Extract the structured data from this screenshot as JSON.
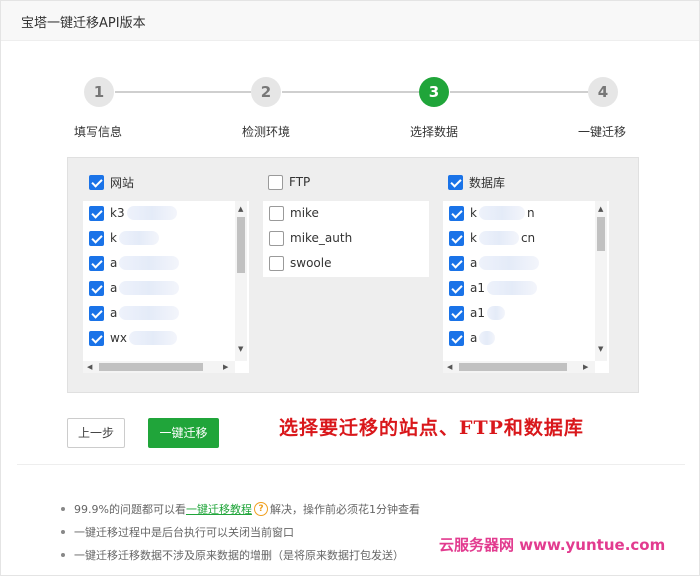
{
  "window": {
    "title": "宝塔一键迁移API版本"
  },
  "steps": [
    {
      "number": "1",
      "label": "填写信息",
      "active": false
    },
    {
      "number": "2",
      "label": "检测环境",
      "active": false
    },
    {
      "number": "3",
      "label": "选择数据",
      "active": true
    },
    {
      "number": "4",
      "label": "一键迁移",
      "active": false
    }
  ],
  "columns": {
    "sites": {
      "header": "网站",
      "checked": true,
      "items": [
        {
          "text": "k3",
          "checked": true
        },
        {
          "text": "k",
          "checked": true
        },
        {
          "text": "a",
          "checked": true
        },
        {
          "text": "a",
          "checked": true
        },
        {
          "text": "a",
          "checked": true
        },
        {
          "text": "wx",
          "checked": true
        }
      ]
    },
    "ftp": {
      "header": "FTP",
      "checked": false,
      "items": [
        {
          "text": "mike",
          "checked": false
        },
        {
          "text": "mike_auth",
          "checked": false
        },
        {
          "text": "swoole",
          "checked": false
        }
      ]
    },
    "databases": {
      "header": "数据库",
      "checked": true,
      "items": [
        {
          "text": "k",
          "suffix": "n",
          "checked": true
        },
        {
          "text": "k",
          "suffix": "cn",
          "checked": true
        },
        {
          "text": "a",
          "checked": true
        },
        {
          "text": "a1",
          "checked": true
        },
        {
          "text": "a1",
          "checked": true
        },
        {
          "text": "a",
          "checked": true
        }
      ]
    }
  },
  "buttons": {
    "prev_label": "上一步",
    "next_label": "一键迁移"
  },
  "annotation": "选择要迁移的站点、FTP和数据库",
  "notes": {
    "line1_prefix": "99.9%的问题都可以看",
    "line1_link": "一键迁移教程",
    "line1_suffix": "解决，操作前必须花1分钟查看",
    "line2": "一键迁移过程中是后台执行可以关闭当前窗口",
    "line3": "一键迁移迁移数据不涉及原来数据的增删（是将原来数据打包发送）"
  },
  "watermark": "云服务器网 www.yuntue.com",
  "colors": {
    "accent_green": "#20a53a",
    "checkbox_blue": "#1a73e8",
    "annotation_red": "#d9171b"
  },
  "icons": {
    "help": "question-circle-icon",
    "checkbox": "checkbox-icon"
  }
}
